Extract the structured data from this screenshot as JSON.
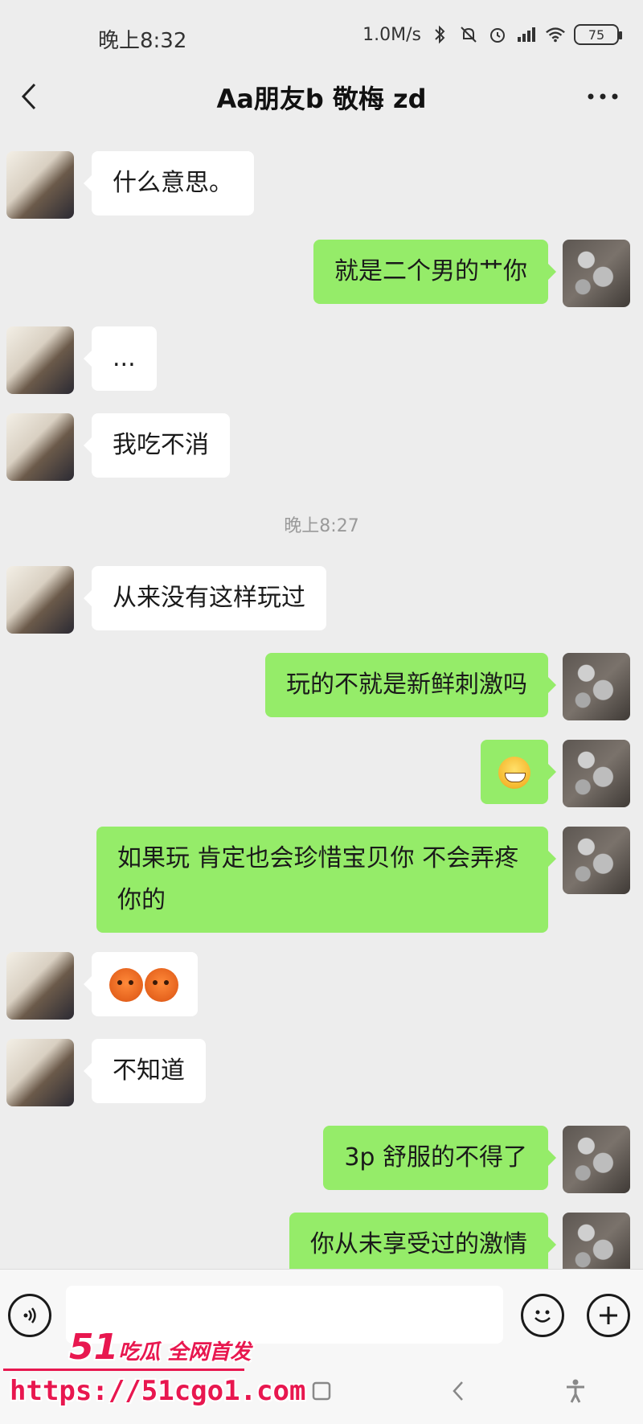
{
  "status_bar": {
    "time": "晚上8:32",
    "network_speed": "1.0M/s",
    "battery": "75"
  },
  "header": {
    "title": "Aa朋友b 敬梅 zd"
  },
  "messages": [
    {
      "side": "left",
      "text": "什么意思。"
    },
    {
      "side": "right",
      "text": "就是二个男的艹你"
    },
    {
      "side": "left",
      "text": "..."
    },
    {
      "side": "left",
      "text": "我吃不消"
    },
    {
      "type": "timestamp",
      "text": "晚上8:27"
    },
    {
      "side": "left",
      "text": "从来没有这样玩过"
    },
    {
      "side": "right",
      "text": "玩的不就是新鲜刺激吗"
    },
    {
      "side": "right",
      "emoji": "grin-emoji"
    },
    {
      "side": "right",
      "text": "如果玩 肯定也会珍惜宝贝你 不会弄疼你的"
    },
    {
      "side": "left",
      "emoji": "blush-emoji-pair"
    },
    {
      "side": "left",
      "text": "不知道"
    },
    {
      "side": "right",
      "text": "3p 舒服的不得了"
    },
    {
      "side": "right",
      "text": "你从未享受过的激情"
    }
  ],
  "watermark": {
    "brand_number": "51",
    "brand_text": "吃瓜 全网首发",
    "url": "https://51cgo1.com"
  },
  "colors": {
    "background": "#ededed",
    "self_bubble": "#95ec69",
    "other_bubble": "#ffffff",
    "watermark": "#e8174f"
  }
}
